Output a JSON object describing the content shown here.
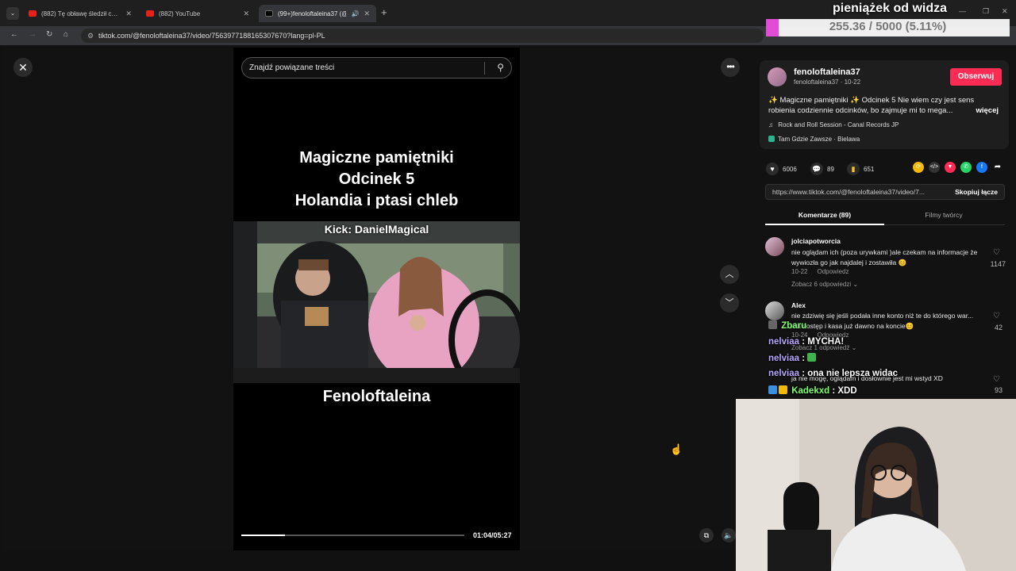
{
  "browser": {
    "tabs": [
      {
        "title": "(882) Tę obławę śledził cały świat",
        "active": false
      },
      {
        "title": "(882) YouTube",
        "active": false
      },
      {
        "title": "(99+)fenoloftaleina37 (@fe...",
        "active": true
      }
    ],
    "new_tab": "+",
    "url": "tiktok.com/@fenoloftaleina37/video/7563977188165307670?lang=pl-PL"
  },
  "search": {
    "placeholder": "Znajdź powiązane treści"
  },
  "video": {
    "title_lines": [
      "Magiczne pamiętniki",
      "Odcinek 5",
      "Holandia i ptasi chleb"
    ],
    "kick_overlay": "Kick: DanielMagical",
    "creator_overlay": "Fenoloftaleina",
    "time": "01:04/05:27",
    "progress": 0.196
  },
  "author": {
    "name": "fenoloftaleina37",
    "handle_date": "fenoloftaleina37 · 10-22",
    "follow_label": "Obserwuj",
    "description": "✨ Magiczne pamiętniki ✨ Odcinek 5 Nie wiem czy jest sens robienia codziennie odcinków, bo zajmuje mi to mega...",
    "more_label": "więcej",
    "music": "Rock and Roll Session - Canal Records JP",
    "location": "Tam Gdzie Zawsze · Bielawa"
  },
  "stats": {
    "likes": "6006",
    "comments": "89",
    "saves": "651"
  },
  "link": {
    "url": "https://www.tiktok.com/@fenoloftaleina37/video/7...",
    "copy_label": "Skopiuj łącze"
  },
  "tabs": {
    "comments": "Komentarze (89)",
    "creator_videos": "Filmy twórcy"
  },
  "comments": [
    {
      "user": "jolciapotworcia",
      "text": "nie oglądam ich (poza urywkami )ale czekam na informacje że wywiozła go jak najdalej i zostawiła 😊",
      "date": "10-22",
      "reply": "Odpowiedz",
      "more_replies": "Zobacz 6 odpowiedzi",
      "likes": "1147"
    },
    {
      "user": "Alex",
      "text": "nie zdziwię się jeśli podała inne konto niż te do którego war... ma dostęp i kasa już dawno na koncie😊",
      "date": "10-24",
      "reply": "Odpowiedz",
      "more_replies": "Zobacz 1 odpowiedź",
      "likes": "42"
    },
    {
      "text": "ja nie mogę, oglądam i dosłownie jest mi wstyd XD",
      "likes": "93"
    }
  ],
  "stream": {
    "donation_title": "pieniążek od widza",
    "donation_text": "255.36 / 5000 (5.11%)",
    "donation_progress": 0.0511,
    "chat": [
      {
        "user": "Zbaru",
        "text": "",
        "color": "#7dff6e"
      },
      {
        "user": "nelviaa",
        "text": "MYCHA!",
        "color": "#b9a6ff"
      },
      {
        "user": "nelviaa",
        "text": "",
        "color": "#b9a6ff"
      },
      {
        "user": "nelviaa",
        "text": "ona nie lepsza widac",
        "color": "#b9a6ff"
      },
      {
        "user": "Kadekxd",
        "text": "XDD",
        "color": "#7dff6e"
      }
    ]
  }
}
